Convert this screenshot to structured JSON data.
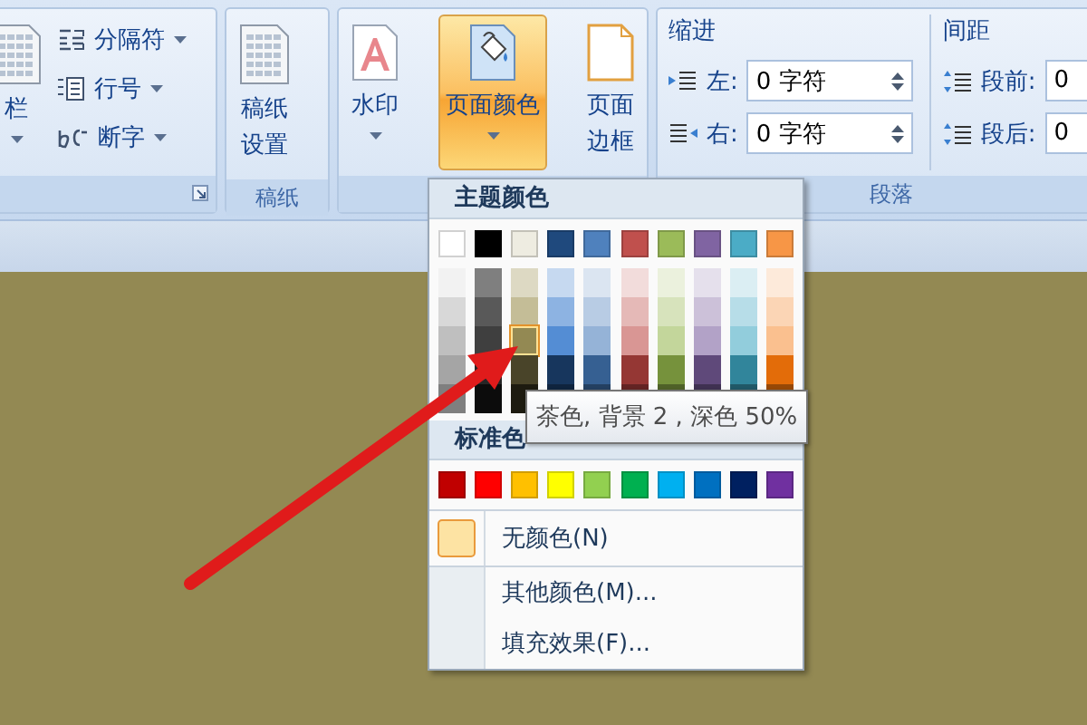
{
  "ribbon": {
    "groups": [
      {
        "kind": "page-setup",
        "big_button": {
          "label": "栏"
        },
        "small_buttons": [
          {
            "label": "分隔符",
            "kind": "breaks"
          },
          {
            "label": "行号",
            "kind": "line-numbers"
          },
          {
            "label": "断字",
            "kind": "hyphenation"
          }
        ]
      },
      {
        "kind": "buttons",
        "title": "稿纸",
        "buttons": [
          {
            "lines": [
              "稿纸",
              "设置"
            ],
            "kind": "grid-paper",
            "caret": false,
            "selected": false
          }
        ]
      },
      {
        "kind": "buttons",
        "buttons": [
          {
            "lines": [
              "水印"
            ],
            "kind": "watermark",
            "caret": true,
            "selected": false
          },
          {
            "lines": [
              "页面颜色"
            ],
            "kind": "page-color",
            "caret": true,
            "selected": true
          },
          {
            "lines": [
              "页面",
              "边框"
            ],
            "kind": "page-border",
            "caret": false,
            "selected": false
          }
        ]
      },
      {
        "kind": "paragraph",
        "title": "段落",
        "sections": [
          {
            "heading": "缩进",
            "fields": [
              {
                "label": "左:",
                "value": "0 字符",
                "kind": "indent-left"
              },
              {
                "label": "右:",
                "value": "0 字符",
                "kind": "indent-right"
              }
            ]
          },
          {
            "heading": "间距",
            "fields": [
              {
                "label": "段前:",
                "value": "0",
                "kind": "space-before"
              },
              {
                "label": "段后:",
                "value": "0",
                "kind": "space-after"
              }
            ]
          }
        ]
      }
    ]
  },
  "color_menu": {
    "theme_heading": "主题颜色",
    "theme_colors": [
      {
        "color": "#ffffff",
        "selected": false
      },
      {
        "color": "#000000",
        "selected": false
      },
      {
        "color": "#eeece1",
        "selected": false
      },
      {
        "color": "#1f497d",
        "selected": false
      },
      {
        "color": "#4f81bd",
        "selected": false
      },
      {
        "color": "#c0504d",
        "selected": false
      },
      {
        "color": "#9bbb59",
        "selected": false
      },
      {
        "color": "#8064a2",
        "selected": false
      },
      {
        "color": "#4bacc6",
        "selected": false
      },
      {
        "color": "#f79646",
        "selected": false
      }
    ],
    "theme_shades": [
      {
        "shades": [
          {
            "color": "#f2f2f2",
            "selected": false
          },
          {
            "color": "#d8d8d8",
            "selected": false
          },
          {
            "color": "#bfbfbf",
            "selected": false
          },
          {
            "color": "#a5a5a5",
            "selected": false
          },
          {
            "color": "#7f7f7f",
            "selected": false
          }
        ]
      },
      {
        "shades": [
          {
            "color": "#7f7f7f",
            "selected": false
          },
          {
            "color": "#595959",
            "selected": false
          },
          {
            "color": "#3f3f3f",
            "selected": false
          },
          {
            "color": "#262626",
            "selected": false
          },
          {
            "color": "#0c0c0c",
            "selected": false
          }
        ]
      },
      {
        "shades": [
          {
            "color": "#ddd9c3",
            "selected": false
          },
          {
            "color": "#c4bd97",
            "selected": false
          },
          {
            "color": "#938953",
            "selected": true
          },
          {
            "color": "#494429",
            "selected": false
          },
          {
            "color": "#1d1b10",
            "selected": false
          }
        ]
      },
      {
        "shades": [
          {
            "color": "#c6d9f0",
            "selected": false
          },
          {
            "color": "#8db3e2",
            "selected": false
          },
          {
            "color": "#548dd4",
            "selected": false
          },
          {
            "color": "#17365d",
            "selected": false
          },
          {
            "color": "#0f243e",
            "selected": false
          }
        ]
      },
      {
        "shades": [
          {
            "color": "#dbe5f1",
            "selected": false
          },
          {
            "color": "#b8cce4",
            "selected": false
          },
          {
            "color": "#95b3d7",
            "selected": false
          },
          {
            "color": "#366092",
            "selected": false
          },
          {
            "color": "#244061",
            "selected": false
          }
        ]
      },
      {
        "shades": [
          {
            "color": "#f2dcdb",
            "selected": false
          },
          {
            "color": "#e5b9b7",
            "selected": false
          },
          {
            "color": "#d99694",
            "selected": false
          },
          {
            "color": "#953734",
            "selected": false
          },
          {
            "color": "#632423",
            "selected": false
          }
        ]
      },
      {
        "shades": [
          {
            "color": "#ebf1dd",
            "selected": false
          },
          {
            "color": "#d7e3bc",
            "selected": false
          },
          {
            "color": "#c3d69b",
            "selected": false
          },
          {
            "color": "#76923c",
            "selected": false
          },
          {
            "color": "#4f6128",
            "selected": false
          }
        ]
      },
      {
        "shades": [
          {
            "color": "#e5e0ec",
            "selected": false
          },
          {
            "color": "#ccc1d9",
            "selected": false
          },
          {
            "color": "#b2a2c7",
            "selected": false
          },
          {
            "color": "#5f497a",
            "selected": false
          },
          {
            "color": "#3f3151",
            "selected": false
          }
        ]
      },
      {
        "shades": [
          {
            "color": "#dbeef3",
            "selected": false
          },
          {
            "color": "#b7dde8",
            "selected": false
          },
          {
            "color": "#92cddc",
            "selected": false
          },
          {
            "color": "#31859b",
            "selected": false
          },
          {
            "color": "#205867",
            "selected": false
          }
        ]
      },
      {
        "shades": [
          {
            "color": "#fdeada",
            "selected": false
          },
          {
            "color": "#fbd5b5",
            "selected": false
          },
          {
            "color": "#fac08f",
            "selected": false
          },
          {
            "color": "#e36c09",
            "selected": false
          },
          {
            "color": "#974806",
            "selected": false
          }
        ]
      }
    ],
    "standard_heading": "标准色",
    "standard_colors": [
      {
        "color": "#c00000",
        "selected": false
      },
      {
        "color": "#ff0000",
        "selected": false
      },
      {
        "color": "#ffc000",
        "selected": false
      },
      {
        "color": "#ffff00",
        "selected": false
      },
      {
        "color": "#92d050",
        "selected": false
      },
      {
        "color": "#00b050",
        "selected": false
      },
      {
        "color": "#00b0f0",
        "selected": false
      },
      {
        "color": "#0070c0",
        "selected": false
      },
      {
        "color": "#002060",
        "selected": false
      },
      {
        "color": "#7030a0",
        "selected": false
      }
    ],
    "items": [
      {
        "label": "无颜色(N)",
        "kind": "no-color"
      },
      {
        "label": "其他颜色(M)...",
        "kind": "plain"
      },
      {
        "label": "填充效果(F)...",
        "kind": "plain"
      }
    ]
  },
  "tooltip": {
    "text": "茶色, 背景 2 , 深色 50%"
  }
}
